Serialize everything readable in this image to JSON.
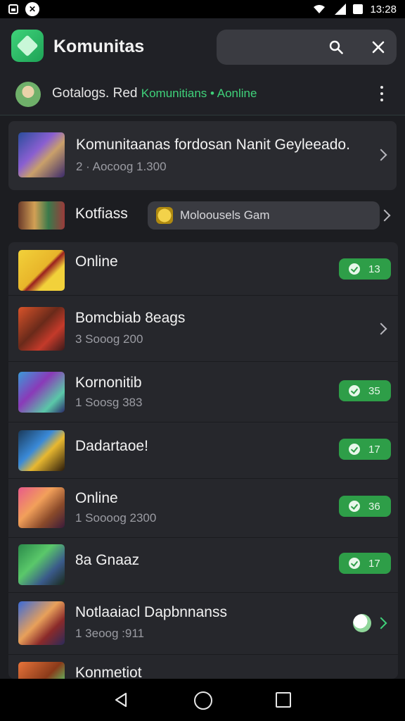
{
  "status_bar": {
    "time": "13:28"
  },
  "app_bar": {
    "title": "Komunitas"
  },
  "sub_header": {
    "text": "Gotalogs. Red",
    "highlight": "Komunitians • Aonline"
  },
  "featured": {
    "title": "Komunitaanas fordosan Nanit Geyleeado.",
    "subtitle": "2 · Aocoog 1.300"
  },
  "filter": {
    "label": "Kotfiass",
    "chip_label": "Moloousels Gam"
  },
  "list_items": [
    {
      "title": "Online",
      "subtitle": "",
      "badge": "13",
      "action": "badge"
    },
    {
      "title": "Bomcbiab 8eags",
      "subtitle": "3 Sooog 200",
      "badge": "",
      "action": "chevron"
    },
    {
      "title": "Kornonitib",
      "subtitle": "1 Soosg 383",
      "badge": "35",
      "action": "badge"
    },
    {
      "title": "Dadartaoe!",
      "subtitle": "",
      "badge": "17",
      "action": "badge"
    },
    {
      "title": "Online",
      "subtitle": "1 Soooog 2300",
      "badge": "36",
      "action": "badge"
    },
    {
      "title": "8a Gnaaz",
      "subtitle": "",
      "badge": "17",
      "action": "badge"
    },
    {
      "title": "Notlaaiacl Dapbnnanss",
      "subtitle": "1 3eoog :911",
      "badge": "",
      "action": "toggle"
    },
    {
      "title": "Konmetiot",
      "subtitle": "",
      "badge": "",
      "action": "partial"
    }
  ],
  "colors": {
    "accent_green": "#3fd27a",
    "badge_green": "#2e9e48",
    "background": "#1c1d21",
    "card": "#2a2b30"
  },
  "icons": [
    "search-icon",
    "close-icon",
    "more-vert-icon",
    "chevron-right-icon",
    "check-icon",
    "back-icon",
    "home-icon",
    "recent-apps-icon"
  ]
}
